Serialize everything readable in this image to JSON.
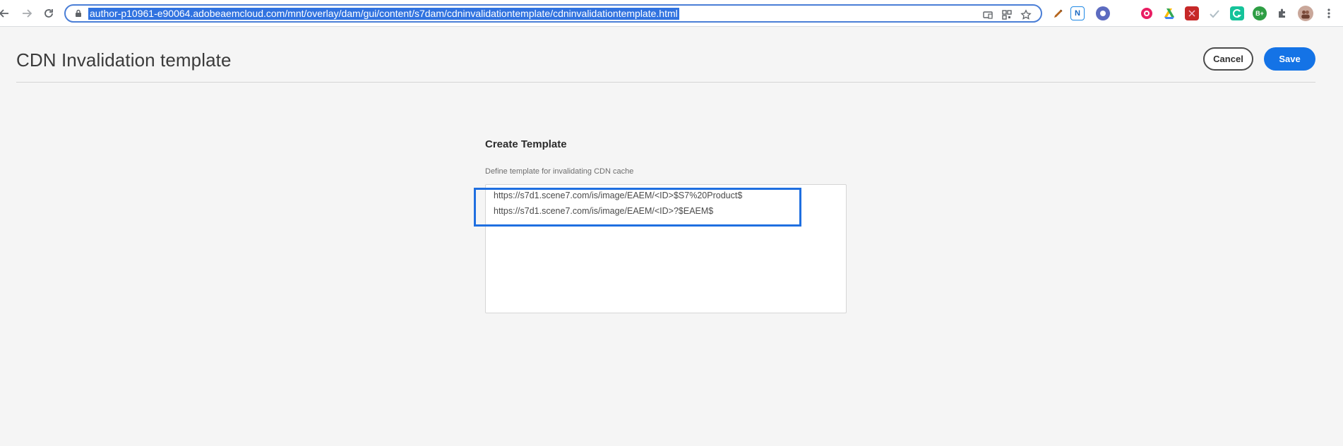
{
  "browser": {
    "url": "author-p10961-e90064.adobeaemcloud.com/mnt/overlay/dam/gui/content/s7dam/cdninvalidationtemplate/cdninvalidationtemplate.html",
    "extension_badges": {
      "n_badge": "N",
      "b_badge": "B+"
    },
    "icons": {
      "back": "back-arrow-icon",
      "forward": "forward-arrow-icon",
      "reload": "reload-icon",
      "lock": "lock-icon",
      "cast": "cast-icon",
      "qr": "qr-code-icon",
      "bookmark": "star-icon",
      "extensions": "puzzle-icon",
      "menu": "kebab-menu-icon"
    },
    "colors": {
      "url_selection": "#3173e0",
      "omnibox_border": "#4a7ed6"
    }
  },
  "page": {
    "title": "CDN Invalidation template",
    "cancel_label": "Cancel",
    "save_label": "Save"
  },
  "form": {
    "heading": "Create Template",
    "label": "Define template for invalidating CDN cache",
    "lines": [
      "https://s7d1.scene7.com/is/image/EAEM/<ID>$S7%20Product$",
      "https://s7d1.scene7.com/is/image/EAEM/<ID>?$EAEM$"
    ]
  },
  "colors": {
    "accent": "#1473e6",
    "highlight_box": "#1f6fe0",
    "background": "#f5f5f5"
  }
}
